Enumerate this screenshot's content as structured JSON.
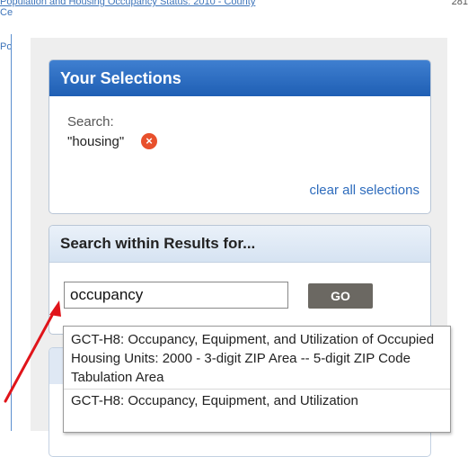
{
  "background": {
    "line1": "Population and Housing Occupancy Status: 2010 - County",
    "line2": "Ce",
    "line3": "Po",
    "number": "281"
  },
  "selections": {
    "title": "Your Selections",
    "search_label": "Search:",
    "search_term": "\"housing\"",
    "remove_icon": "×",
    "clear_link": "clear all selections"
  },
  "search_within": {
    "title": "Search within Results for...",
    "input_value": "occupancy",
    "go_label": "GO"
  },
  "autocomplete": {
    "items": [
      "GCT-H8: Occupancy, Equipment, and Utilization of Occupied Housing Units: 2000 - 3-digit ZIP Area -- 5-digit ZIP Code Tabulation Area",
      "GCT-H8: Occupancy, Equipment, and Utilization"
    ]
  },
  "colors": {
    "header_blue": "#2a6cc2",
    "go_button": "#6b6862",
    "remove_red": "#e8502c",
    "arrow_red": "#e0141a"
  }
}
